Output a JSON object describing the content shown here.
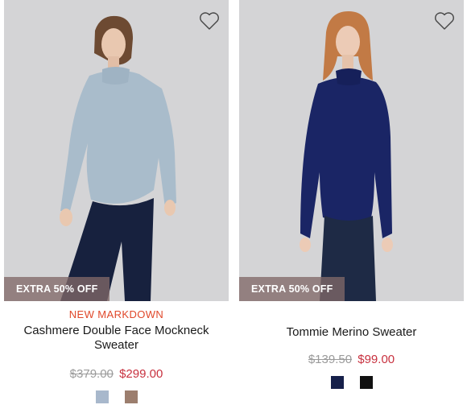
{
  "products": [
    {
      "promo": "EXTRA 50% OFF",
      "label": "NEW MARKDOWN",
      "name": "Cashmere Double Face Mockneck Sweater",
      "original_price": "$379.00",
      "sale_price": "$299.00",
      "swatches": [
        {
          "name": "light-blue",
          "color": "#a8b8cc"
        },
        {
          "name": "taupe",
          "color": "#9c7e6e"
        }
      ],
      "wishlist_icon": "heart-outline-icon",
      "sweater_color": "#a9bccb",
      "pants_color": "#17213e",
      "hair_color": "#6d4a32"
    },
    {
      "promo": "EXTRA 50% OFF",
      "label": "",
      "name": "Tommie Merino Sweater",
      "original_price": "$139.50",
      "sale_price": "$99.00",
      "swatches": [
        {
          "name": "navy",
          "color": "#16204a"
        },
        {
          "name": "black",
          "color": "#111111"
        }
      ],
      "wishlist_icon": "heart-outline-icon",
      "sweater_color": "#1a2565",
      "pants_color": "#1e2a45",
      "hair_color": "#c27a45"
    }
  ],
  "colors": {
    "photo_background": "#d4d4d6",
    "promo_badge": "#806868",
    "markdown_label": "#e0482a",
    "sale_price": "#c8313f",
    "original_price": "#9b9b9b"
  }
}
